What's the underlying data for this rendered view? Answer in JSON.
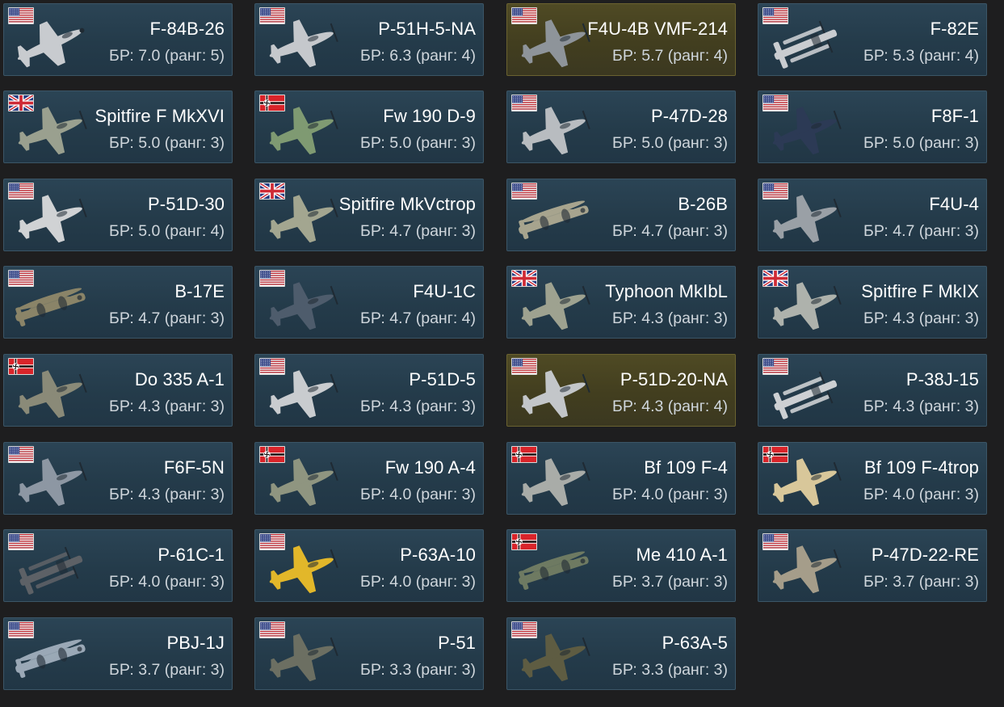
{
  "colors": {
    "page_bg": "#1e1e1f",
    "card_bg": "#243b4a",
    "card_highlight_bg": "#423e1f",
    "title_text": "#ffffff",
    "br_text": "#cfd6dc"
  },
  "cards": [
    {
      "name": "F-84B-26",
      "br": "БР: 7.0 (ранг: 5)",
      "flag": "usa-flag-icon",
      "aircraft": "jet",
      "paint": "#c8cbcf",
      "highlight": false
    },
    {
      "name": "P-51H-5-NA",
      "br": "БР: 6.3 (ранг: 4)",
      "flag": "usa-flag-icon",
      "aircraft": "fighter",
      "paint": "#c5c8cc",
      "highlight": false
    },
    {
      "name": "F4U-4B VMF-214",
      "br": "БР: 5.7 (ранг: 4)",
      "flag": "usa-flag-icon",
      "aircraft": "fighter",
      "paint": "#8e949a",
      "highlight": true
    },
    {
      "name": "F-82E",
      "br": "БР: 5.3 (ранг: 4)",
      "flag": "usa-flag-icon",
      "aircraft": "twin",
      "paint": "#c9ccd0",
      "highlight": false
    },
    {
      "name": "Spitfire F MkXVI",
      "br": "БР: 5.0 (ранг: 3)",
      "flag": "uk-flag-icon",
      "aircraft": "fighter",
      "paint": "#9aa08f",
      "highlight": false
    },
    {
      "name": "Fw 190 D-9",
      "br": "БР: 5.0 (ранг: 3)",
      "flag": "germany-flag-icon",
      "aircraft": "fighter",
      "paint": "#7f9a72",
      "highlight": false
    },
    {
      "name": "P-47D-28",
      "br": "БР: 5.0 (ранг: 3)",
      "flag": "usa-flag-icon",
      "aircraft": "fighter",
      "paint": "#b8bcc0",
      "highlight": false
    },
    {
      "name": "F8F-1",
      "br": "БР: 5.0 (ранг: 3)",
      "flag": "usa-flag-icon",
      "aircraft": "fighter",
      "paint": "#2c3a55",
      "highlight": false
    },
    {
      "name": "P-51D-30",
      "br": "БР: 5.0 (ранг: 4)",
      "flag": "usa-flag-icon",
      "aircraft": "fighter",
      "paint": "#d0d2d4",
      "highlight": false
    },
    {
      "name": "Spitfire MkVctrop",
      "br": "БР: 4.7 (ранг: 3)",
      "flag": "uk-flag-icon",
      "aircraft": "fighter",
      "paint": "#a3a690",
      "highlight": false
    },
    {
      "name": "B-26B",
      "br": "БР: 4.7 (ранг: 3)",
      "flag": "usa-flag-icon",
      "aircraft": "bomber",
      "paint": "#a7a48e",
      "highlight": false
    },
    {
      "name": "F4U-4",
      "br": "БР: 4.7 (ранг: 3)",
      "flag": "usa-flag-icon",
      "aircraft": "fighter",
      "paint": "#9aa0a6",
      "highlight": false
    },
    {
      "name": "B-17E",
      "br": "БР: 4.7 (ранг: 3)",
      "flag": "usa-flag-icon",
      "aircraft": "bomber",
      "paint": "#8a8468",
      "highlight": false
    },
    {
      "name": "F4U-1C",
      "br": "БР: 4.7 (ранг: 4)",
      "flag": "usa-flag-icon",
      "aircraft": "fighter",
      "paint": "#4e5c6c",
      "highlight": false
    },
    {
      "name": "Typhoon MkIbL",
      "br": "БР: 4.3 (ранг: 3)",
      "flag": "uk-flag-icon",
      "aircraft": "fighter",
      "paint": "#9ea290",
      "highlight": false
    },
    {
      "name": "Spitfire F MkIX",
      "br": "БР: 4.3 (ранг: 3)",
      "flag": "uk-flag-icon",
      "aircraft": "fighter",
      "paint": "#aeb2ac",
      "highlight": false
    },
    {
      "name": "Do 335 A-1",
      "br": "БР: 4.3 (ранг: 3)",
      "flag": "germany-flag-icon",
      "aircraft": "fighter",
      "paint": "#8a8a78",
      "highlight": false
    },
    {
      "name": "P-51D-5",
      "br": "БР: 4.3 (ранг: 3)",
      "flag": "usa-flag-icon",
      "aircraft": "fighter",
      "paint": "#c9cccf",
      "highlight": false
    },
    {
      "name": "P-51D-20-NA",
      "br": "БР: 4.3 (ранг: 4)",
      "flag": "usa-flag-icon",
      "aircraft": "fighter",
      "paint": "#c3c6c9",
      "highlight": true
    },
    {
      "name": "P-38J-15",
      "br": "БР: 4.3 (ранг: 3)",
      "flag": "usa-flag-icon",
      "aircraft": "twin",
      "paint": "#cdd0d3",
      "highlight": false
    },
    {
      "name": "F6F-5N",
      "br": "БР: 4.3 (ранг: 3)",
      "flag": "usa-flag-icon",
      "aircraft": "fighter",
      "paint": "#8d97a3",
      "highlight": false
    },
    {
      "name": "Fw 190 A-4",
      "br": "БР: 4.0 (ранг: 3)",
      "flag": "germany-flag-icon",
      "aircraft": "fighter",
      "paint": "#8f9580",
      "highlight": false
    },
    {
      "name": "Bf 109 F-4",
      "br": "БР: 4.0 (ранг: 3)",
      "flag": "germany-flag-icon",
      "aircraft": "fighter",
      "paint": "#a9aca8",
      "highlight": false
    },
    {
      "name": "Bf 109 F-4trop",
      "br": "БР: 4.0 (ранг: 3)",
      "flag": "germany-flag-icon",
      "aircraft": "fighter",
      "paint": "#d8c79a",
      "highlight": false
    },
    {
      "name": "P-61C-1",
      "br": "БР: 4.0 (ранг: 3)",
      "flag": "usa-flag-icon",
      "aircraft": "twin",
      "paint": "#5d6166",
      "highlight": false
    },
    {
      "name": "P-63A-10",
      "br": "БР: 4.0 (ранг: 3)",
      "flag": "usa-flag-icon",
      "aircraft": "fighter",
      "paint": "#e2b72a",
      "highlight": false
    },
    {
      "name": "Me 410 A-1",
      "br": "БР: 3.7 (ранг: 3)",
      "flag": "germany-flag-icon",
      "aircraft": "bomber",
      "paint": "#6e7a62",
      "highlight": false
    },
    {
      "name": "P-47D-22-RE",
      "br": "БР: 3.7 (ранг: 3)",
      "flag": "usa-flag-icon",
      "aircraft": "fighter",
      "paint": "#a59d8a",
      "highlight": false
    },
    {
      "name": "PBJ-1J",
      "br": "БР: 3.7 (ранг: 3)",
      "flag": "usa-flag-icon",
      "aircraft": "bomber",
      "paint": "#9aa8b6",
      "highlight": false
    },
    {
      "name": "P-51",
      "br": "БР: 3.3 (ранг: 3)",
      "flag": "usa-flag-icon",
      "aircraft": "fighter",
      "paint": "#6c6f62",
      "highlight": false
    },
    {
      "name": "P-63A-5",
      "br": "БР: 3.3 (ранг: 3)",
      "flag": "usa-flag-icon",
      "aircraft": "fighter",
      "paint": "#5e5c42",
      "highlight": false
    }
  ]
}
